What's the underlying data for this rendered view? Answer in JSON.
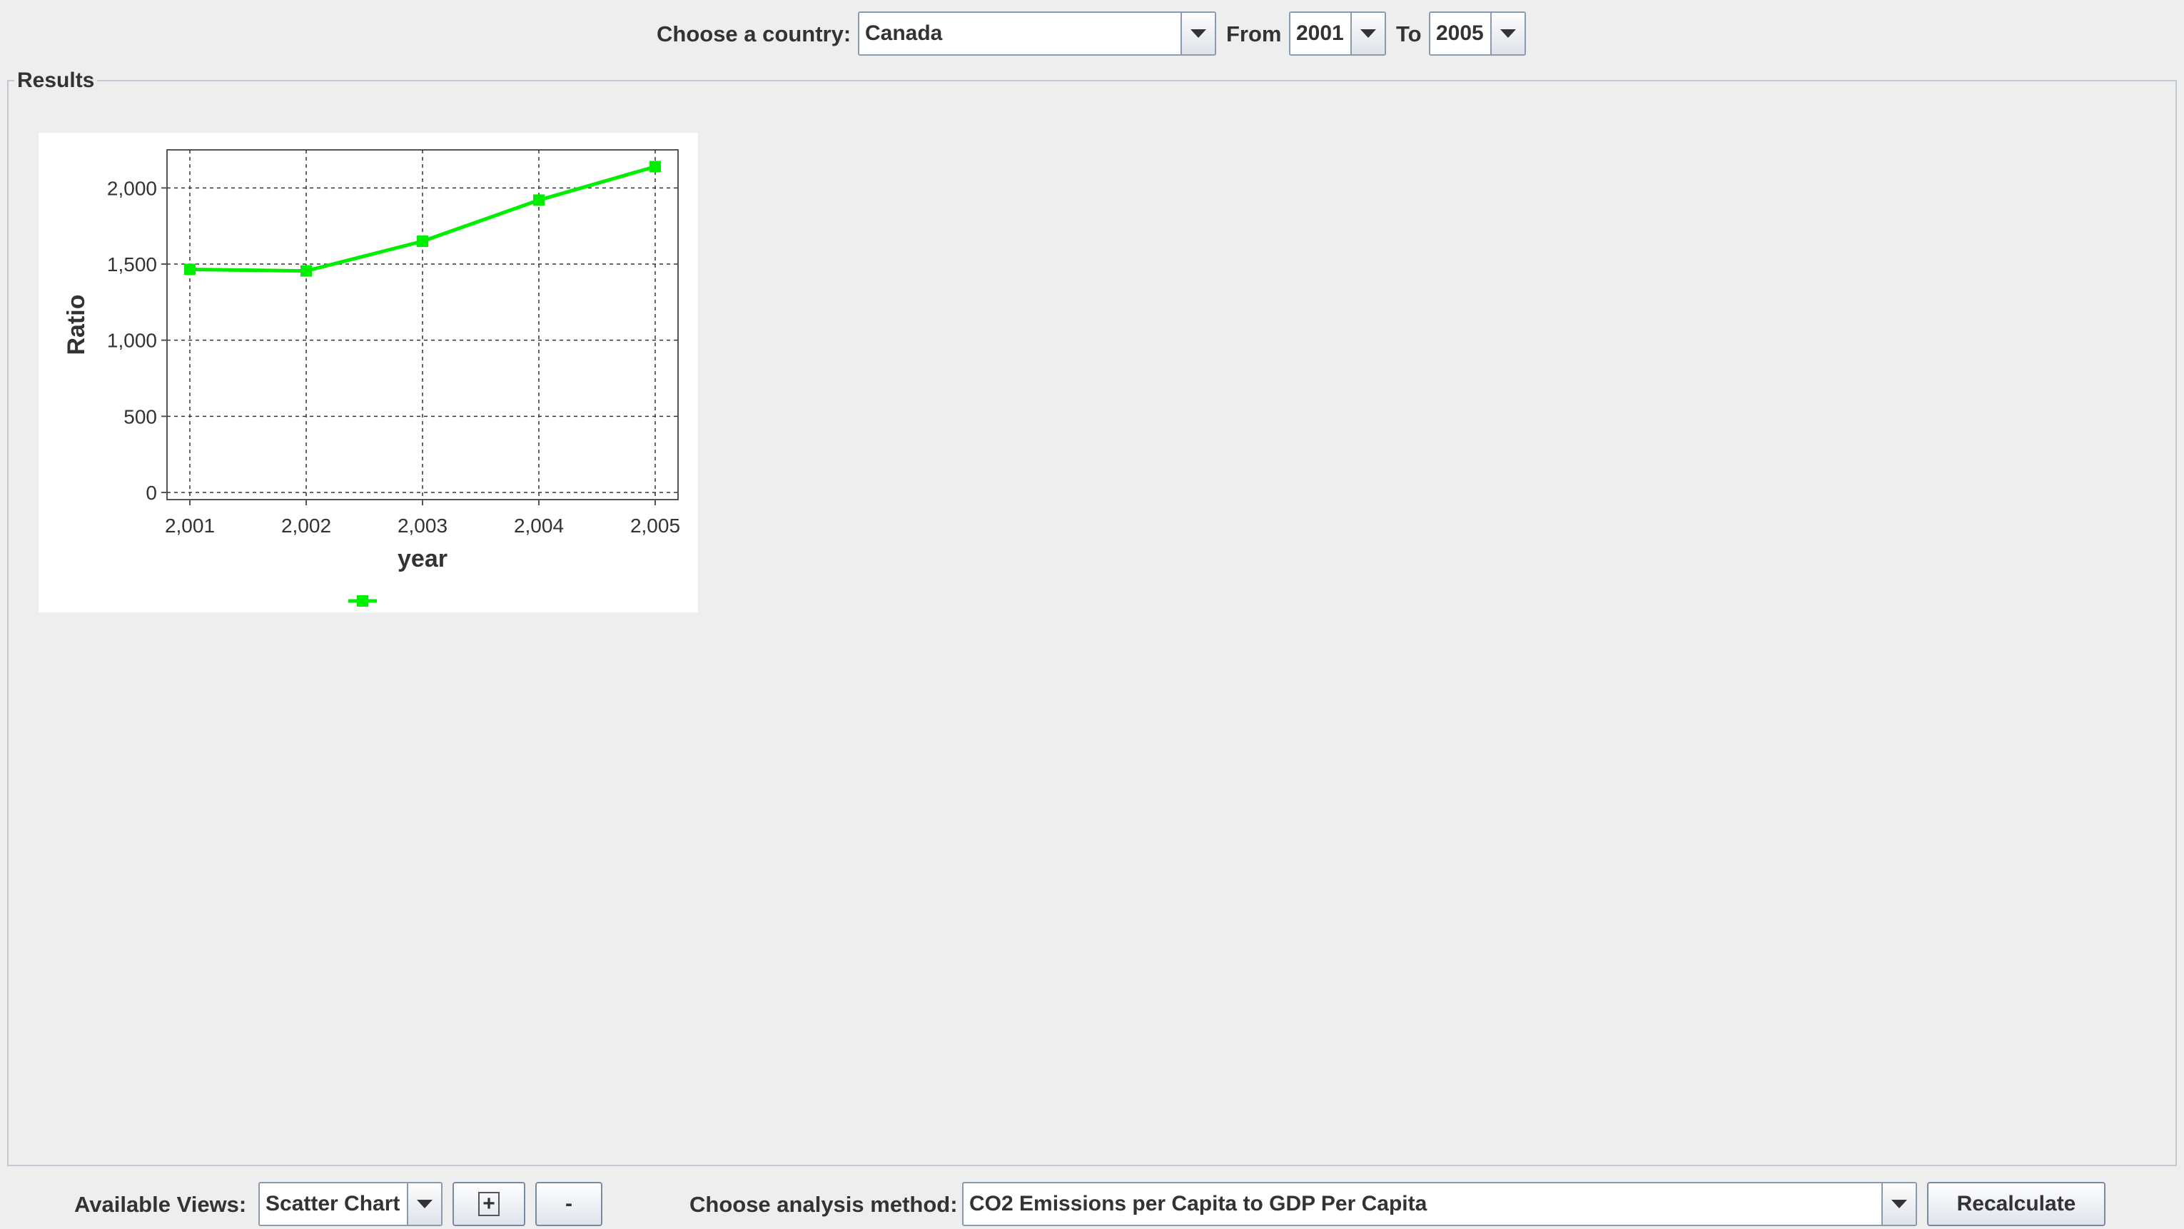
{
  "top_bar": {
    "country_label": "Choose a country:",
    "country_value": "Canada",
    "from_label": "From",
    "from_value": "2001",
    "to_label": "To",
    "to_value": "2005"
  },
  "results": {
    "title": "Results"
  },
  "chart_data": {
    "type": "line",
    "xlabel": "year",
    "ylabel": "Ratio",
    "x": [
      2001,
      2002,
      2003,
      2004,
      2005
    ],
    "x_tick_labels": [
      "2,001",
      "2,002",
      "2,003",
      "2,004",
      "2,005"
    ],
    "y_ticks": [
      0,
      500,
      1000,
      1500,
      2000
    ],
    "y_tick_labels": [
      "0",
      "500",
      "1,000",
      "1,500",
      "2,000"
    ],
    "ylim": [
      0,
      2250
    ],
    "grid": true,
    "series": [
      {
        "values": [
          1465,
          1455,
          1650,
          1920,
          2140
        ],
        "color": "#00ee00"
      }
    ],
    "legend_position": "bottom"
  },
  "bottom_bar": {
    "views_label": "Available Views:",
    "views_value": "Scatter Chart",
    "add_label": "+",
    "remove_label": "-",
    "method_label": "Choose analysis method:",
    "method_value": "CO2 Emissions per Capita to GDP Per Capita",
    "recalculate_label": "Recalculate"
  }
}
